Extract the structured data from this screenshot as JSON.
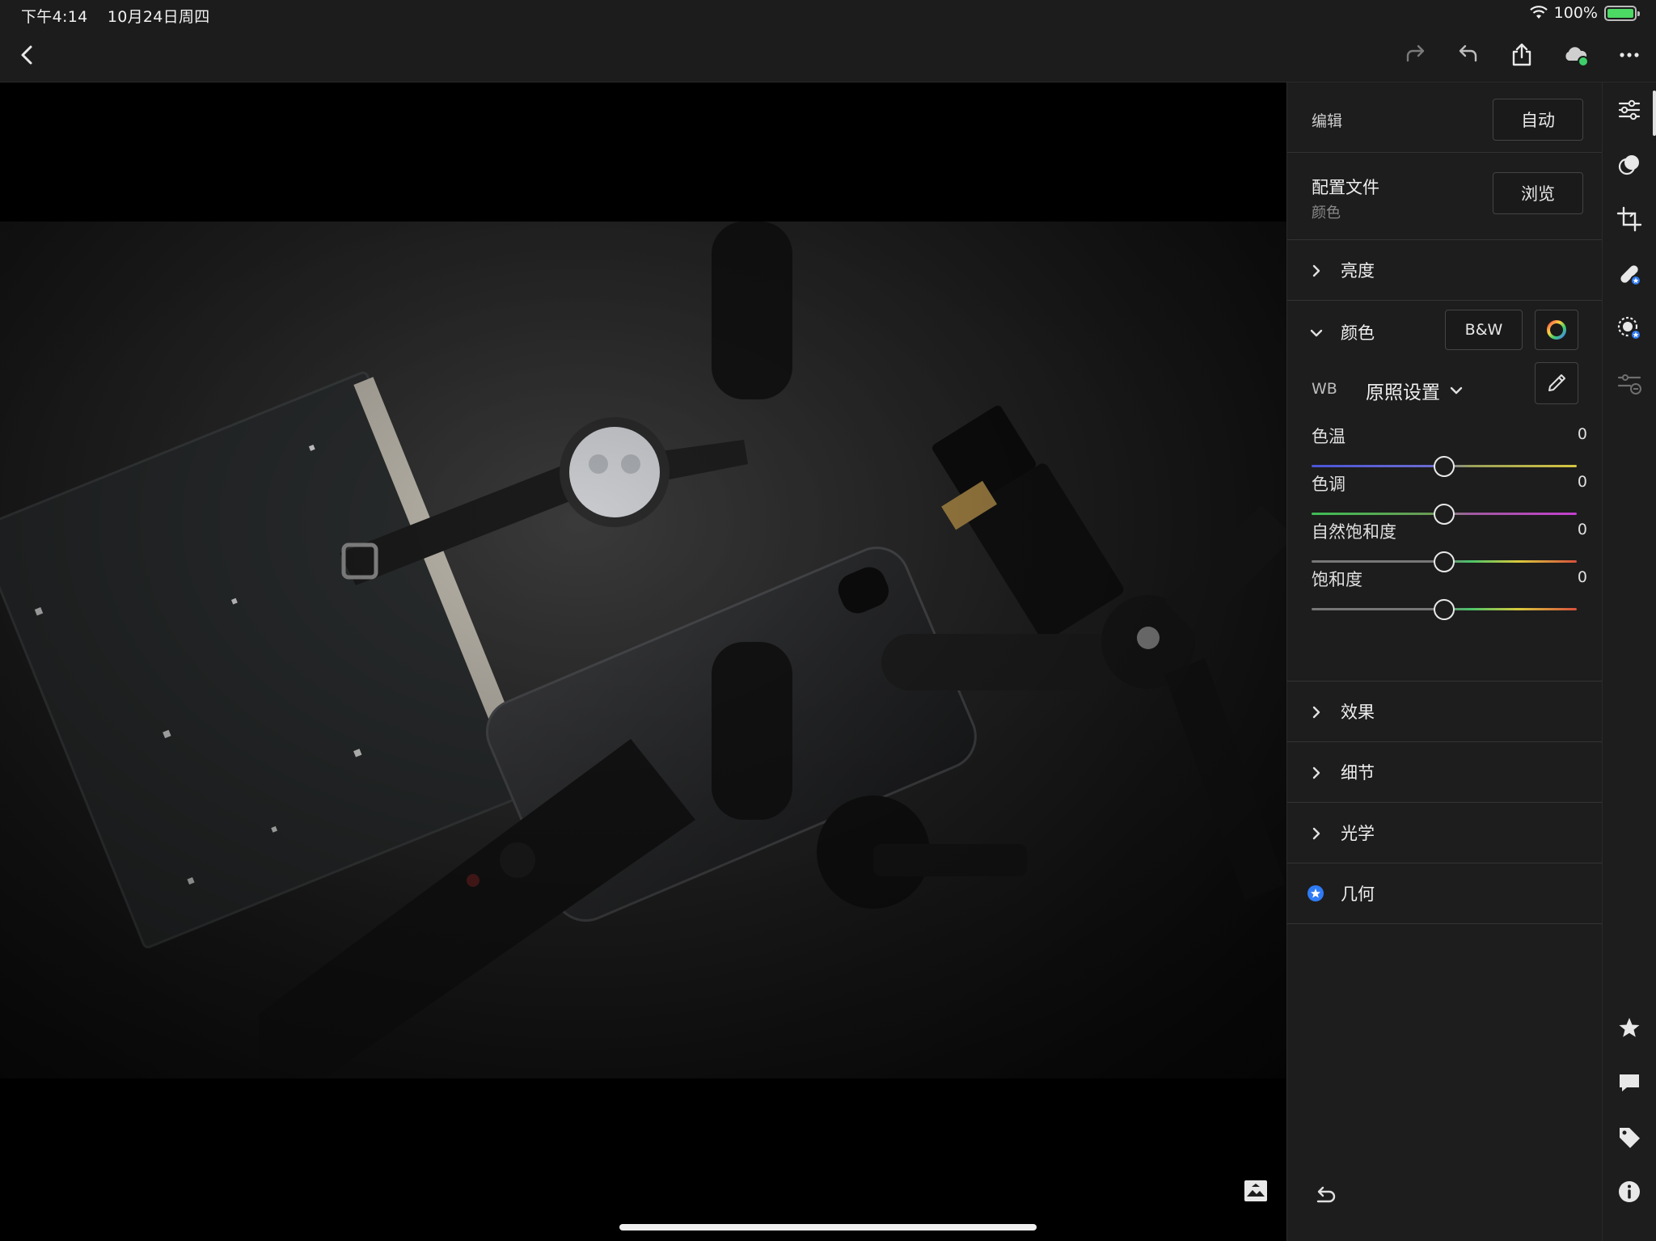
{
  "status_bar": {
    "time": "下午4:14",
    "date": "10月24日周四",
    "battery": "100%"
  },
  "toolbar": {
    "back": "back-icon",
    "redo": "redo-icon",
    "undo": "undo-icon",
    "share": "share-icon",
    "cloud": "cloud-sync-icon",
    "more": "more-icon"
  },
  "panel": {
    "edit_label": "编辑",
    "auto_button": "自动",
    "profile_title": "配置文件",
    "profile_value": "颜色",
    "browse_button": "浏览",
    "sections": {
      "light": "亮度",
      "color": "颜色",
      "effects": "效果",
      "detail": "细节",
      "optics": "光学",
      "geometry": "几何"
    },
    "bw_button": "B&W",
    "wb_label": "WB",
    "wb_value": "原照设置",
    "sliders": [
      {
        "name": "色温",
        "value": "0"
      },
      {
        "name": "色调",
        "value": "0"
      },
      {
        "name": "自然饱和度",
        "value": "0"
      },
      {
        "name": "饱和度",
        "value": "0"
      }
    ]
  },
  "rail": {
    "items": [
      "edit-sliders-icon",
      "presets-icon",
      "crop-icon",
      "healing-icon",
      "masking-icon",
      "versions-icon",
      "star-icon",
      "comment-icon",
      "tag-icon",
      "info-icon"
    ]
  },
  "colors": {
    "accent": "#2f7bf5",
    "panel_bg": "#1d1d1d",
    "cloud_dot": "#3ecf6a"
  }
}
